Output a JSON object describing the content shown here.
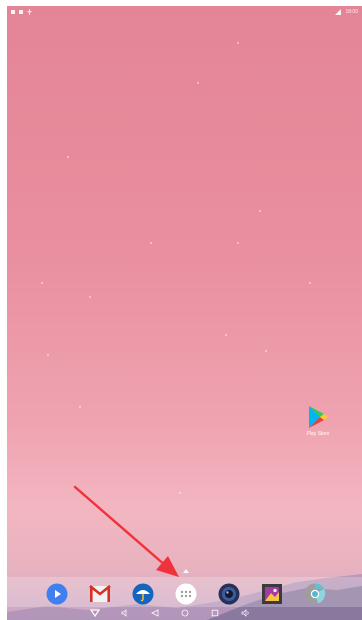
{
  "status_bar": {
    "time": "18:00"
  },
  "desktop": {
    "play_store": {
      "label": "Play Store",
      "icon": "play-store-icon"
    }
  },
  "dock": {
    "items": [
      {
        "name": "Play",
        "icon": "play-circle-icon"
      },
      {
        "name": "Gmail",
        "icon": "gmail-icon"
      },
      {
        "name": "Weather",
        "icon": "umbrella-icon"
      },
      {
        "name": "All apps",
        "icon": "app-drawer-icon"
      },
      {
        "name": "Camera",
        "icon": "camera-lens-icon"
      },
      {
        "name": "Gallery",
        "icon": "photo-gallery-icon"
      },
      {
        "name": "Chrome",
        "icon": "chrome-icon"
      }
    ]
  },
  "nav_bar": {
    "buttons": [
      "collapse-icon",
      "volume-down-icon",
      "back-icon",
      "home-icon",
      "recents-icon",
      "volume-up-icon"
    ]
  },
  "annotation": {
    "arrow_color": "#f0323c"
  },
  "colors": {
    "wallpaper_top": "#e48597",
    "wallpaper_bottom": "#c8a7c6"
  }
}
